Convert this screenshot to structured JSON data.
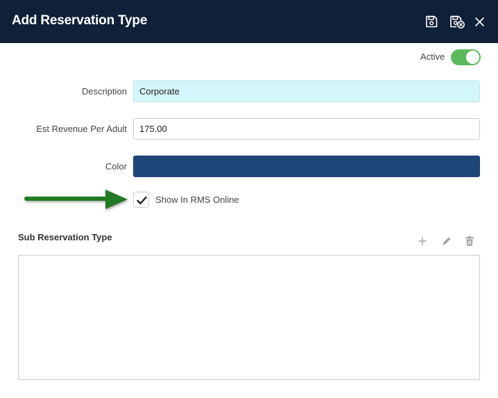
{
  "header": {
    "title": "Add Reservation Type",
    "buttons": {
      "save": "save-icon",
      "save_close": "save-close-icon",
      "close": "close-icon"
    }
  },
  "status": {
    "label": "Active",
    "enabled": true
  },
  "form": {
    "description": {
      "label": "Description",
      "value": "Corporate"
    },
    "revenue": {
      "label": "Est Revenue Per Adult",
      "value": "175.00"
    },
    "color": {
      "label": "Color",
      "value": "#1f4679"
    },
    "show_online": {
      "label": "Show In RMS Online",
      "checked": true
    }
  },
  "sub_types": {
    "title": "Sub Reservation Type",
    "tools": [
      "add-icon",
      "edit-icon",
      "delete-icon"
    ],
    "rows": []
  },
  "colors": {
    "header_bg": "#0f2038",
    "toggle_on": "#5cb85c",
    "arrow": "#217a21",
    "description_bg": "#d3f6fb"
  }
}
